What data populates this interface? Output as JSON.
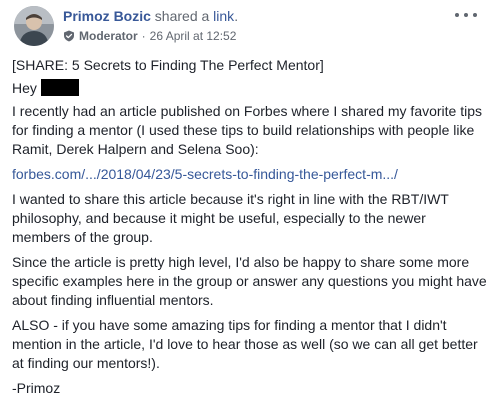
{
  "post": {
    "author": "Primoz Bozic",
    "action_prefix": "shared a",
    "action_link": "link",
    "action_suffix": ".",
    "role": "Moderator",
    "date_separator": "·",
    "timestamp": "26 April at 12:52",
    "paragraphs": {
      "title": "[SHARE: 5 Secrets to Finding The Perfect Mentor]",
      "greeting": "Hey",
      "p1": "I recently had an article published on Forbes where I shared my favorite tips for finding a mentor (I used these tips to build relationships with people like Ramit, Derek Halpern and Selena Soo):",
      "link": "forbes.com/.../2018/04/23/5-secrets-to-finding-the-perfect-m.../",
      "p2": "I wanted to share this article because it's right in line with the RBT/IWT philosophy, and because it might be useful, especially to the newer members of the group.",
      "p3": "Since the article is pretty high level, I'd also be happy to share some more specific examples here in the group or answer any questions you might have about finding influential mentors.",
      "p4": "ALSO - if you have some amazing tips for finding a mentor that I didn't mention in the article, I'd love to hear those as well (so we can all get better at finding our mentors!).",
      "signoff": "-Primoz"
    }
  },
  "icons": {
    "menu": "more-options-icon",
    "role": "moderator-shield-icon"
  },
  "colors": {
    "author_link": "#385898",
    "body_link": "#365899",
    "meta_text": "#616770",
    "body_text": "#1d2129"
  }
}
